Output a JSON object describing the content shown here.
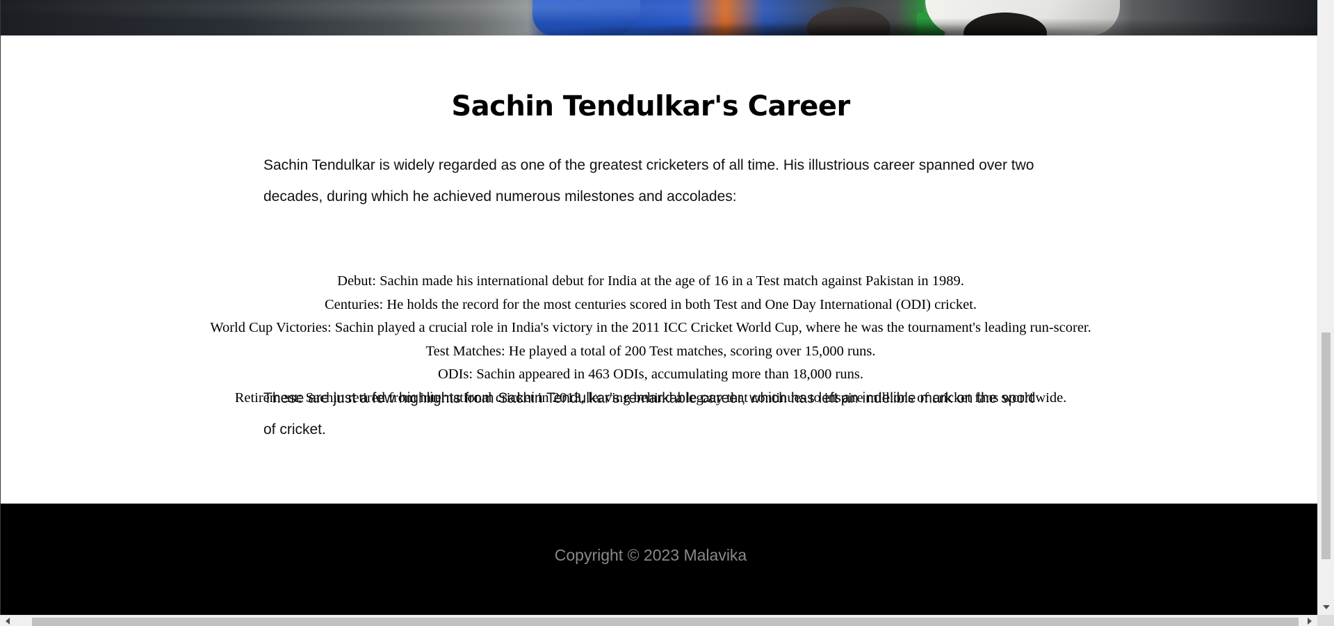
{
  "hero": {
    "image_label": "cricket-celebration-photo"
  },
  "main": {
    "title": "Sachin Tendulkar's Career",
    "intro": "Sachin Tendulkar is widely regarded as one of the greatest cricketers of all time. His illustrious career spanned over two decades, during which he achieved numerous milestones and accolades:",
    "highlights": [
      "Debut: Sachin made his international debut for India at the age of 16 in a Test match against Pakistan in 1989.",
      "Centuries: He holds the record for the most centuries scored in both Test and One Day International (ODI) cricket.",
      "World Cup Victories: Sachin played a crucial role in India's victory in the 2011 ICC Cricket World Cup, where he was the tournament's leading run-scorer.",
      "Test Matches: He played a total of 200 Test matches, scoring over 15,000 runs.",
      "ODIs: Sachin appeared in 463 ODIs, accumulating more than 18,000 runs.",
      "Retirement: Sachin retired from international cricket in 2013, leaving behind a legacy that continues to inspire millions of cricket fans worldwide."
    ],
    "outro": "These are just a few highlights from Sachin Tendulkar's remarkable career, which has left an indelible mark on the sport of cricket."
  },
  "footer": {
    "copyright": "Copyright © 2023 Malavika"
  },
  "colors": {
    "footer_bg": "#000000",
    "footer_text": "#8a8a8a",
    "page_bg": "#ffffff"
  }
}
